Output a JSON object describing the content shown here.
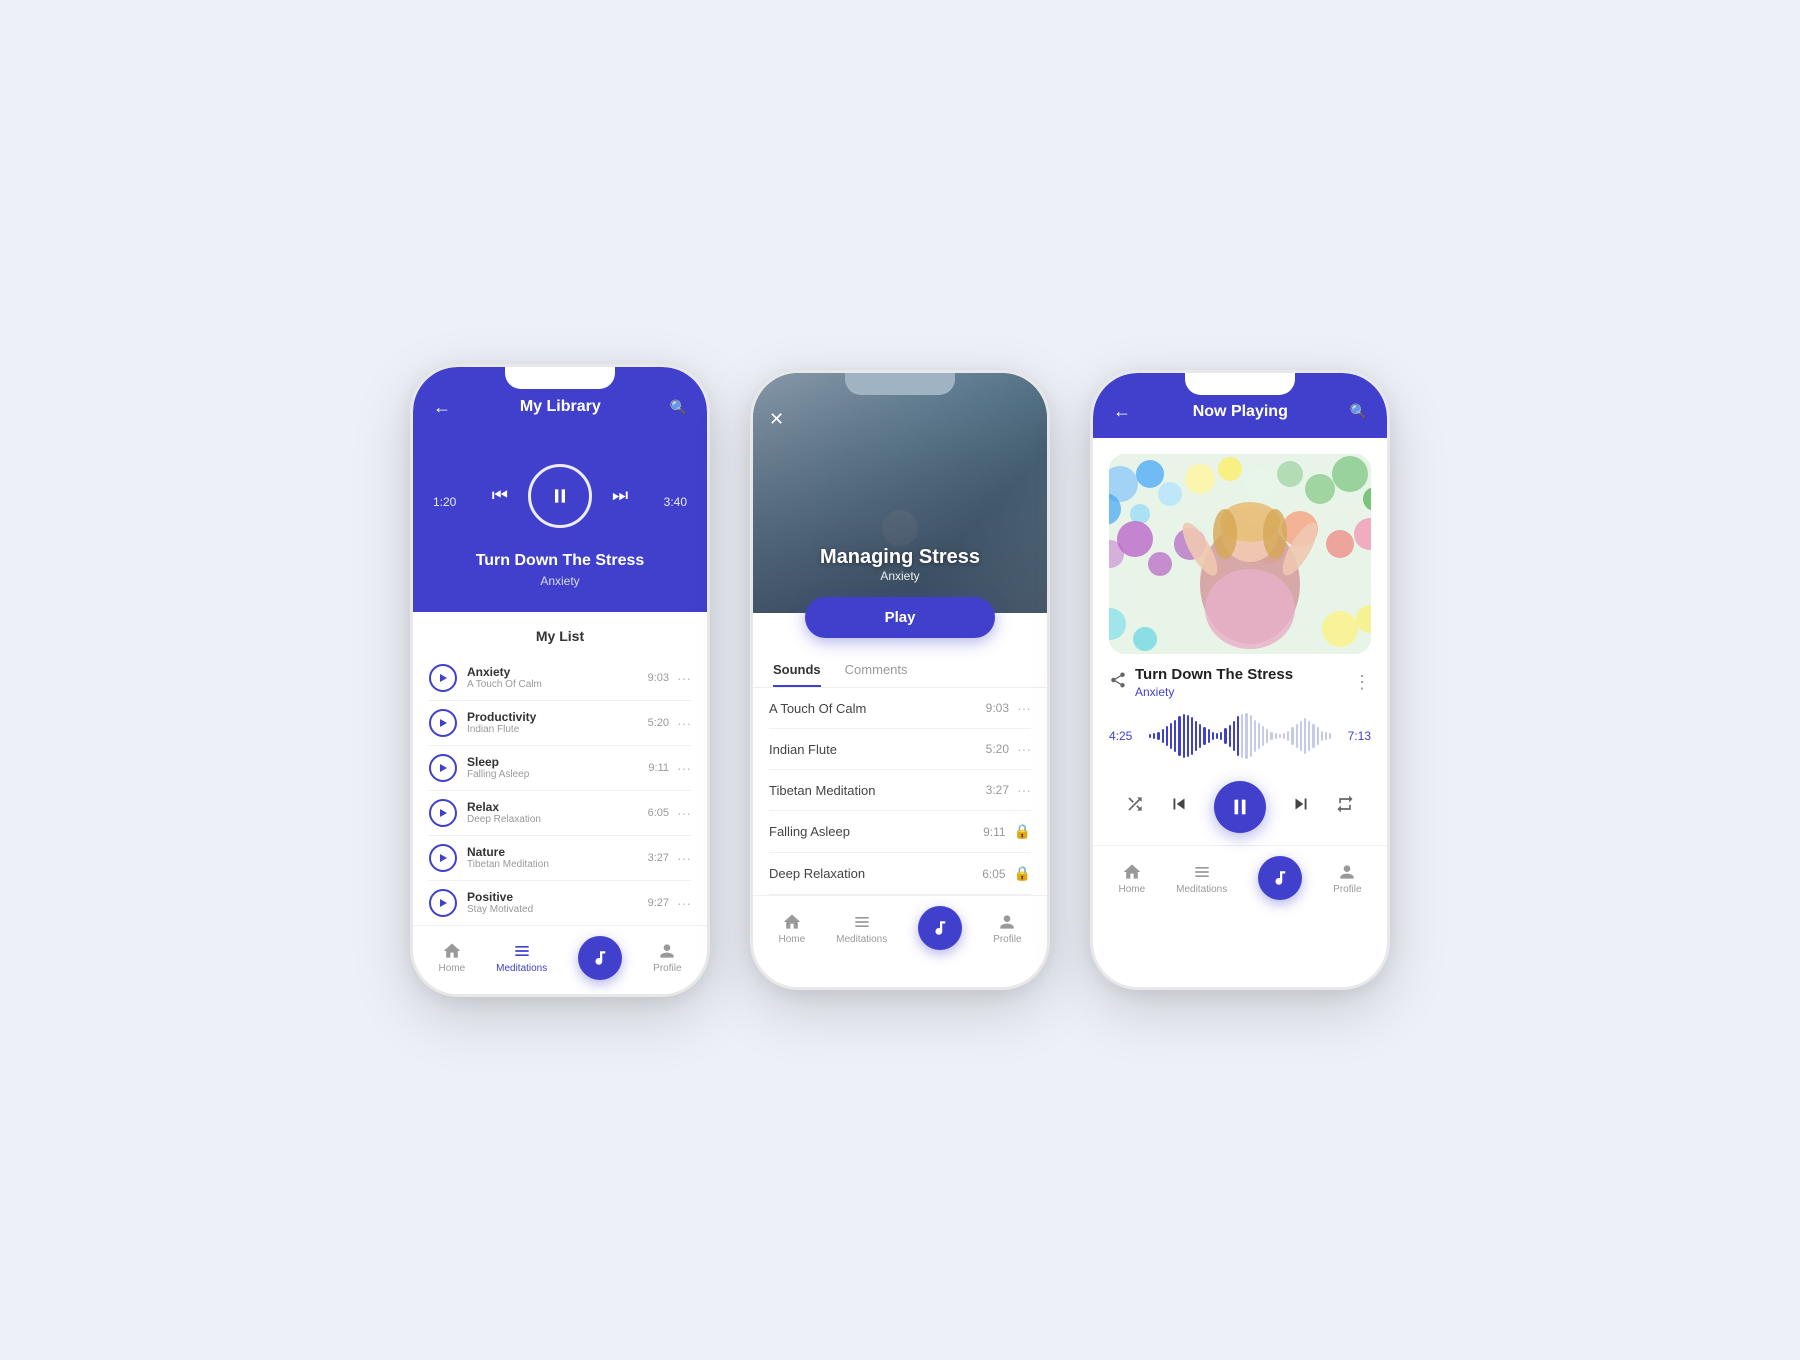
{
  "phone1": {
    "header": {
      "title": "My Library",
      "back": "←",
      "search": "🔍"
    },
    "player": {
      "time_current": "1:20",
      "time_total": "3:40",
      "track_name": "Turn Down The Stress",
      "track_sub": "Anxiety"
    },
    "my_list_title": "My List",
    "tracks": [
      {
        "name": "Anxiety",
        "sub": "A Touch Of Calm",
        "time": "9:03"
      },
      {
        "name": "Productivity",
        "sub": "Indian Flute",
        "time": "5:20"
      },
      {
        "name": "Sleep",
        "sub": "Falling Asleep",
        "time": "9:11"
      },
      {
        "name": "Relax",
        "sub": "Deep Relaxation",
        "time": "6:05"
      },
      {
        "name": "Nature",
        "sub": "Tibetan Meditation",
        "time": "3:27"
      },
      {
        "name": "Positive",
        "sub": "Stay Motivated",
        "time": "9:27"
      }
    ],
    "nav": {
      "home": "Home",
      "meditations": "Meditations",
      "profile": "Profile"
    }
  },
  "phone2": {
    "close": "✕",
    "track_title": "Managing Stress",
    "track_sub": "Anxiety",
    "play_label": "Play",
    "tabs": [
      "Sounds",
      "Comments"
    ],
    "active_tab": "Sounds",
    "sounds": [
      {
        "name": "A Touch Of Calm",
        "time": "9:03",
        "locked": false
      },
      {
        "name": "Indian Flute",
        "time": "5:20",
        "locked": false
      },
      {
        "name": "Tibetan Meditation",
        "time": "3:27",
        "locked": false
      },
      {
        "name": "Falling Asleep",
        "time": "9:11",
        "locked": true
      },
      {
        "name": "Deep Relaxation",
        "time": "6:05",
        "locked": true
      }
    ],
    "nav": {
      "home": "Home",
      "meditations": "Meditations",
      "profile": "Profile"
    }
  },
  "phone3": {
    "header": {
      "title": "Now Playing",
      "back": "←",
      "search": "🔍"
    },
    "track_name": "Turn Down The Stress",
    "track_sub": "Anxiety",
    "time_current": "4:25",
    "time_total": "7:13",
    "waveform_bars": [
      3,
      5,
      8,
      12,
      18,
      24,
      30,
      36,
      40,
      38,
      34,
      28,
      22,
      16,
      12,
      8,
      6,
      8,
      14,
      20,
      28,
      36,
      40,
      42,
      38,
      30,
      24,
      18,
      12,
      8,
      5,
      4,
      6,
      10,
      16,
      22,
      28,
      32,
      28,
      22,
      16,
      10,
      7,
      5
    ],
    "waveform_active_count": 22,
    "nav": {
      "home": "Home",
      "meditations": "Meditations",
      "profile": "Profile"
    }
  },
  "icons": {
    "play": "▶",
    "pause": "⏸",
    "prev": "⏮",
    "next": "⏭",
    "shuffle": "⇌",
    "repeat": "↺",
    "share": "⤴",
    "more": "⋮",
    "lock": "🔒",
    "dots": "···"
  }
}
